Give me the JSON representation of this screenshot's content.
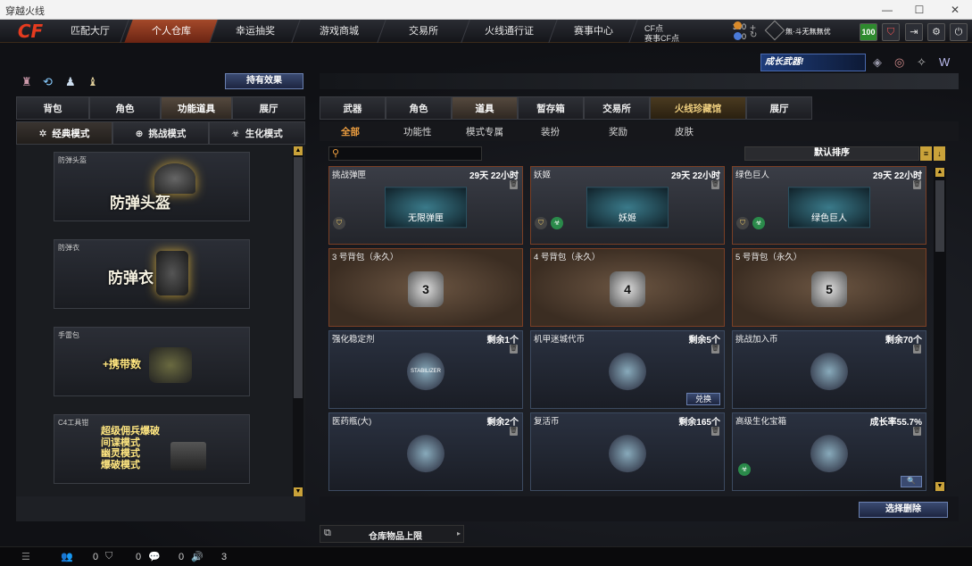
{
  "window": {
    "title": "穿越火线"
  },
  "nav": [
    "匹配大厅",
    "个人仓库",
    "幸运抽奖",
    "游戏商城",
    "交易所",
    "火线通行证",
    "赛事中心"
  ],
  "currency": {
    "cf_label": "CF点",
    "cf_value": "300",
    "event_label": "赛事CF点",
    "event_value": "0"
  },
  "user": {
    "title": "無·斗无無無优",
    "level": "100"
  },
  "left": {
    "effect_button": "持有效果",
    "tabs": [
      "背包",
      "角色",
      "功能道具",
      "展厅"
    ],
    "modes": [
      "经典模式",
      "挑战模式",
      "生化模式"
    ],
    "cards": [
      {
        "title": "防弹头盔",
        "label": "防弹头盔"
      },
      {
        "title": "防弹衣",
        "label": "防弹衣"
      },
      {
        "title": "手雷包",
        "label": "+携带数"
      },
      {
        "title": "C4工具钳",
        "lines": [
          "超级佣兵爆破",
          "间谍模式",
          "幽灵模式",
          "爆破模式"
        ]
      }
    ]
  },
  "banner": "成长武器!",
  "right": {
    "tabs": [
      "武器",
      "角色",
      "道具",
      "暂存箱",
      "交易所",
      "火线珍藏馆",
      "展厅"
    ],
    "subtabs": [
      "全部",
      "功能性",
      "模式专属",
      "装扮",
      "奖励",
      "皮肤"
    ],
    "sort_label": "默认排序",
    "items": [
      {
        "name": "挑战弹匣",
        "right": "29天 22小时",
        "pic": "无限弹匣",
        "style": ""
      },
      {
        "name": "妖姬",
        "right": "29天 22小时",
        "pic": "妖姬",
        "style": ""
      },
      {
        "name": "绿色巨人",
        "right": "29天 22小时",
        "pic": "绿色巨人",
        "style": ""
      },
      {
        "name": "3 号背包（永久）",
        "right": "",
        "pic": "3",
        "style": "brown"
      },
      {
        "name": "4 号背包（永久）",
        "right": "",
        "pic": "4",
        "style": "brown"
      },
      {
        "name": "5 号背包（永久）",
        "right": "",
        "pic": "5",
        "style": "brown"
      },
      {
        "name": "强化稳定剂",
        "right": "剩余1个",
        "pic": "STABILIZER",
        "style": "blue"
      },
      {
        "name": "机甲迷城代币",
        "right": "剩余5个",
        "pic": "",
        "style": "blue",
        "action": "兑换"
      },
      {
        "name": "挑战加入币",
        "right": "剩余70个",
        "pic": "",
        "style": "blue"
      },
      {
        "name": "医药瓶(大)",
        "right": "剩余2个",
        "pic": "",
        "style": "blue"
      },
      {
        "name": "复活币",
        "right": "剩余165个",
        "pic": "",
        "style": "blue"
      },
      {
        "name": "高级生化宝箱",
        "right": "成长率55.7%",
        "pic": "",
        "style": "blue"
      }
    ],
    "batch_delete": "选择删除",
    "capacity": "仓库物品上限"
  },
  "status": {
    "c1": "0",
    "c2": "0",
    "c3": "0",
    "c4": "3"
  }
}
